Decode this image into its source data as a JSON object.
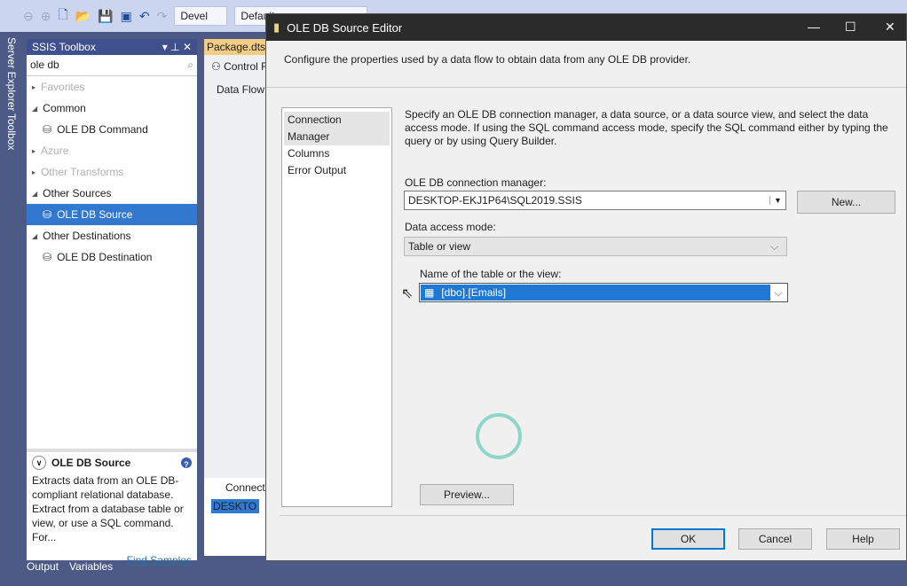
{
  "toolbar": {
    "config_combo": "Devel",
    "platform_combo": "Default"
  },
  "side_tabs": [
    "Server Explorer",
    "Toolbox"
  ],
  "toolbox": {
    "title": "SSIS Toolbox",
    "search_value": "ole db",
    "groups": [
      {
        "label": "Favorites",
        "dim": true
      },
      {
        "label": "Common"
      },
      {
        "label": "OLE DB Command",
        "item": true
      },
      {
        "label": "Azure",
        "dim": true
      },
      {
        "label": "Other Transforms",
        "dim": true
      },
      {
        "label": "Other Sources"
      },
      {
        "label": "OLE DB Source",
        "item": true,
        "selected": true
      },
      {
        "label": "Other Destinations"
      },
      {
        "label": "OLE DB Destination",
        "item": true
      }
    ],
    "desc_title": "OLE DB Source",
    "desc_text": "Extracts data from an OLE DB-compliant relational database. Extract from a database table or view, or use a SQL command. For...",
    "find_samples": "Find Samples"
  },
  "bottom_tabs": [
    "Output",
    "Variables"
  ],
  "document": {
    "tab": "Package.dtsx",
    "control_flow": "Control F",
    "data_flow": "Data Flow T",
    "connections": "Connecti",
    "conn_item": "DESKTO"
  },
  "dialog": {
    "title": "OLE DB Source Editor",
    "intro": "Configure the properties used by a data flow to obtain data from any OLE DB provider.",
    "nav": [
      "Connection Manager",
      "Columns",
      "Error Output"
    ],
    "help_text": "Specify an OLE DB connection manager, a data source, or a data source view, and select the data access mode. If using the SQL command access mode, specify the SQL command either by typing the query or by using Query Builder.",
    "conn_label": "OLE DB connection manager:",
    "conn_value": "DESKTOP-EKJ1P64\\SQL2019.SSIS",
    "new_button": "New...",
    "mode_label": "Data access mode:",
    "mode_value": "Table or view",
    "table_label": "Name of the table or the view:",
    "table_value": "[dbo].[Emails]",
    "preview_button": "Preview...",
    "ok": "OK",
    "cancel": "Cancel",
    "help": "Help"
  }
}
